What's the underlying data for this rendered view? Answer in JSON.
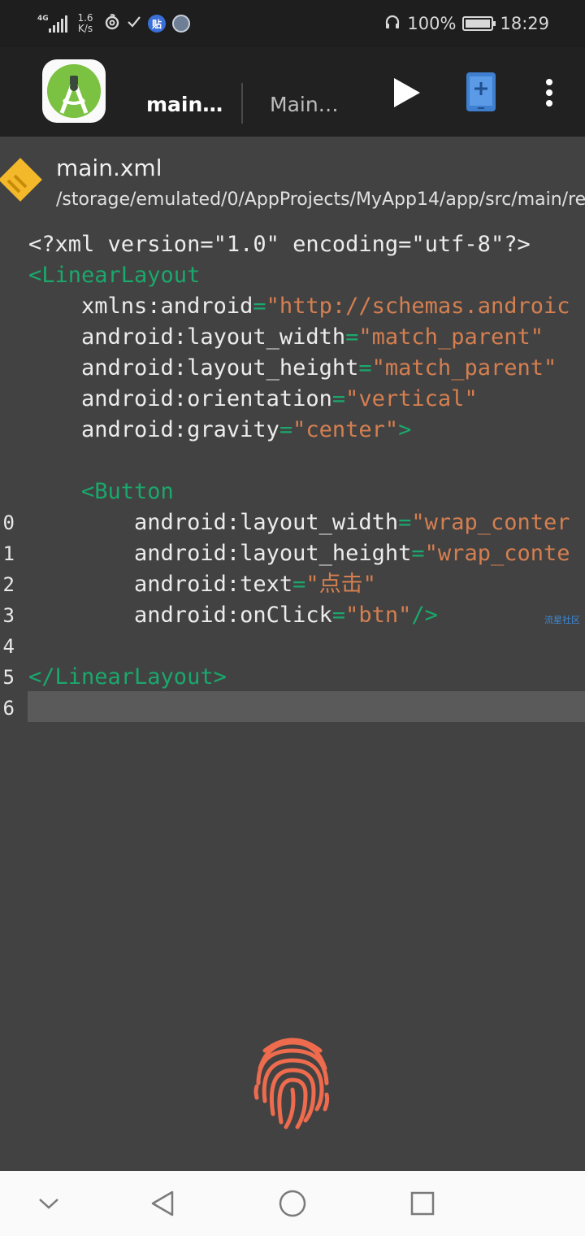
{
  "status_bar": {
    "network": "4G",
    "network_speed": "1.6\nK/s",
    "battery_percent": "100%",
    "time": "18:29",
    "badge_tieba": "贴"
  },
  "toolbar": {
    "tabs": [
      {
        "label": "main…",
        "active": true
      },
      {
        "label": "Main…",
        "active": false
      }
    ]
  },
  "file": {
    "name": "main.xml",
    "path": "/storage/emulated/0/AppProjects/MyApp14/app/src/main/re"
  },
  "editor": {
    "lines": [
      {
        "num": "",
        "tokens": [
          {
            "t": "plain",
            "s": "<?xml version=\"1.0\" encoding=\"utf-8\"?>"
          }
        ]
      },
      {
        "num": "",
        "tokens": [
          {
            "t": "tag",
            "s": "<LinearLayout"
          }
        ]
      },
      {
        "num": "",
        "tokens": [
          {
            "t": "attr",
            "s": "    xmlns:android"
          },
          {
            "t": "eq",
            "s": "="
          },
          {
            "t": "val",
            "s": "\"http://schemas.androic"
          }
        ]
      },
      {
        "num": "",
        "tokens": [
          {
            "t": "attr",
            "s": "    android:layout_width"
          },
          {
            "t": "eq",
            "s": "="
          },
          {
            "t": "val",
            "s": "\"match_parent\""
          }
        ]
      },
      {
        "num": "",
        "tokens": [
          {
            "t": "attr",
            "s": "    android:layout_height"
          },
          {
            "t": "eq",
            "s": "="
          },
          {
            "t": "val",
            "s": "\"match_parent\""
          }
        ]
      },
      {
        "num": "",
        "tokens": [
          {
            "t": "attr",
            "s": "    android:orientation"
          },
          {
            "t": "eq",
            "s": "="
          },
          {
            "t": "val",
            "s": "\"vertical\""
          }
        ]
      },
      {
        "num": "",
        "tokens": [
          {
            "t": "attr",
            "s": "    android:gravity"
          },
          {
            "t": "eq",
            "s": "="
          },
          {
            "t": "val",
            "s": "\"center\""
          },
          {
            "t": "tag",
            "s": ">"
          }
        ]
      },
      {
        "num": "",
        "tokens": []
      },
      {
        "num": "",
        "tokens": [
          {
            "t": "tag",
            "s": "    <Button"
          }
        ]
      },
      {
        "num": "0",
        "tokens": [
          {
            "t": "attr",
            "s": "        android:layout_width"
          },
          {
            "t": "eq",
            "s": "="
          },
          {
            "t": "val",
            "s": "\"wrap_conter"
          }
        ]
      },
      {
        "num": "1",
        "tokens": [
          {
            "t": "attr",
            "s": "        android:layout_height"
          },
          {
            "t": "eq",
            "s": "="
          },
          {
            "t": "val",
            "s": "\"wrap_conte"
          }
        ]
      },
      {
        "num": "2",
        "tokens": [
          {
            "t": "attr",
            "s": "        android:text"
          },
          {
            "t": "eq",
            "s": "="
          },
          {
            "t": "val",
            "s": "\"点击\""
          }
        ]
      },
      {
        "num": "3",
        "tokens": [
          {
            "t": "attr",
            "s": "        android:onClick"
          },
          {
            "t": "eq",
            "s": "="
          },
          {
            "t": "val",
            "s": "\"btn\""
          },
          {
            "t": "tag",
            "s": "/>"
          }
        ]
      },
      {
        "num": "4",
        "tokens": []
      },
      {
        "num": "5",
        "tokens": [
          {
            "t": "tag",
            "s": "</LinearLayout>"
          }
        ]
      },
      {
        "num": "6",
        "tokens": []
      }
    ],
    "watermark": "流星社区"
  },
  "icons": {
    "run": "play-icon",
    "device": "new-file-device-icon",
    "more": "more-vert-icon",
    "fingerprint": "fingerprint-icon",
    "nav_down": "chevron-down-icon",
    "nav_back": "back-triangle-icon",
    "nav_home": "home-circle-icon",
    "nav_recent": "recent-square-icon"
  },
  "colors": {
    "tag": "#1aa86c",
    "value": "#d57f50",
    "editor_bg": "#424242",
    "toolbar_bg": "#212121",
    "fingerprint": "#ee6b4d"
  }
}
